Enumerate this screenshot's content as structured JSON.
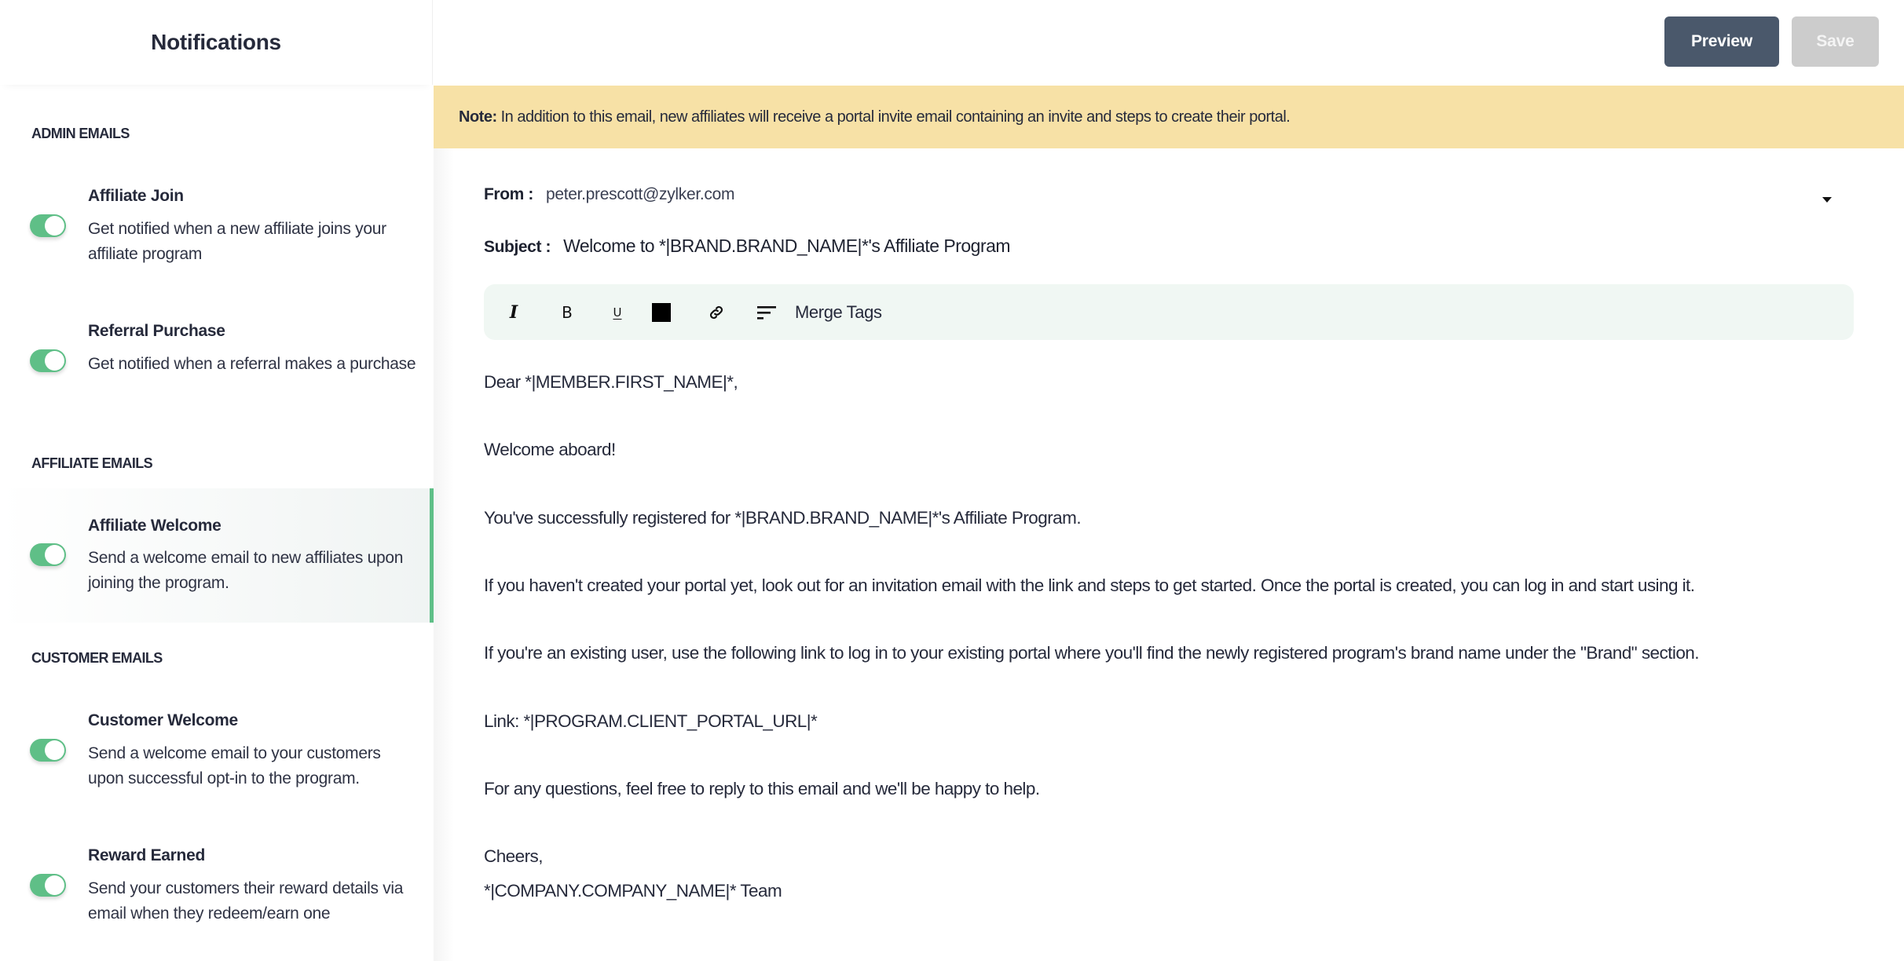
{
  "sidebar": {
    "title": "Notifications",
    "sections": [
      {
        "heading": "ADMIN EMAILS",
        "items": [
          {
            "title": "Affiliate Join",
            "description": "Get notified when a new affiliate joins your affiliate program",
            "enabled": true,
            "active": false
          },
          {
            "title": "Referral Purchase",
            "description": "Get notified when a referral makes a purchase",
            "enabled": true,
            "active": false
          }
        ]
      },
      {
        "heading": "AFFILIATE EMAILS",
        "items": [
          {
            "title": "Affiliate Welcome",
            "description": "Send a welcome email to new affiliates upon joining the program.",
            "enabled": true,
            "active": true
          }
        ]
      },
      {
        "heading": "CUSTOMER EMAILS",
        "items": [
          {
            "title": "Customer Welcome",
            "description": "Send a welcome email to your customers upon successful opt-in to the program.",
            "enabled": true,
            "active": false
          },
          {
            "title": "Reward Earned",
            "description": "Send your customers their reward details via email when they redeem/earn one",
            "enabled": true,
            "active": false
          }
        ]
      }
    ]
  },
  "topbar": {
    "preview_label": "Preview",
    "save_label": "Save",
    "save_disabled": true
  },
  "note": {
    "label": "Note:",
    "text": "In addition to this email, new affiliates will receive a portal invite email containing an invite and steps to create their portal."
  },
  "email": {
    "from_label": "From :",
    "from_value": "peter.prescott@zylker.com",
    "subject_label": "Subject :",
    "subject_value": "Welcome to *|BRAND.BRAND_NAME|*'s Affiliate Program",
    "toolbar": {
      "italic": "I",
      "bold": "B",
      "underline": "U",
      "text_color": "#000000",
      "merge_tags_label": "Merge Tags"
    },
    "body_lines": [
      "Dear *|MEMBER.FIRST_NAME|*,",
      "Welcome aboard!",
      "You've successfully registered for *|BRAND.BRAND_NAME|*'s Affiliate Program.",
      "If you haven't created your portal yet, look out for an invitation email with the link and steps to get started. Once the portal is created, you can log in and start using it.",
      "If you're an existing user, use the following link to log in to your existing portal where you'll find the newly registered program's brand name under the \"Brand\" section.",
      "Link: *|PROGRAM.CLIENT_PORTAL_URL|*",
      "For any questions, feel free to reply to this email and we'll be happy to help.",
      "Cheers,",
      "*|COMPANY.COMPANY_NAME|* Team"
    ]
  },
  "colors": {
    "accent_green": "#5fbf87",
    "preview_button": "#4a586b",
    "save_button_disabled": "#cccccc",
    "note_background": "#f7e1a6",
    "toolbar_background": "#f0f7f3"
  }
}
